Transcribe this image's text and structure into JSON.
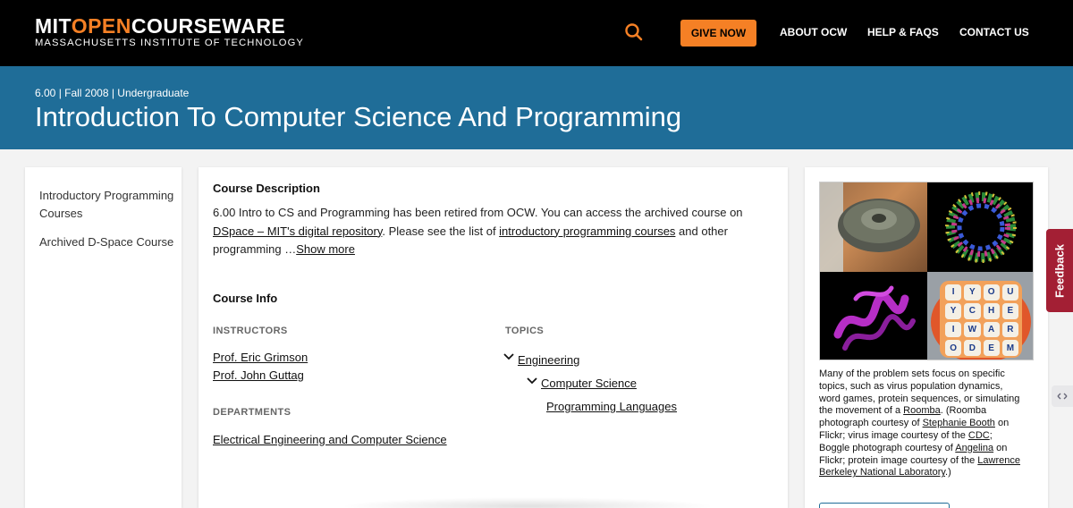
{
  "header": {
    "logo_mit": "MIT",
    "logo_open": "OPEN",
    "logo_courseware": "COURSEWARE",
    "logo_sub": "MASSACHUSETTS INSTITUTE OF TECHNOLOGY",
    "give_now": "GIVE NOW",
    "nav": [
      "ABOUT OCW",
      "HELP & FAQS",
      "CONTACT US"
    ]
  },
  "banner": {
    "meta": "6.00 | Fall 2008 | Undergraduate",
    "title": "Introduction To Computer Science And Programming"
  },
  "sidebar": {
    "items": [
      "Introductory Programming Courses",
      "Archived D-Space Course"
    ]
  },
  "course": {
    "description_heading": "Course Description",
    "desc_1": "6.00 Intro to CS and Programming has been retired from OCW. You can access the archived course on ",
    "desc_link_1": "DSpace – MIT's digital repository",
    "desc_2": ". Please see the list of ",
    "desc_link_2": "introductory programming courses",
    "desc_3": " and other programming …",
    "show_more": "Show more",
    "info_heading": "Course Info",
    "instructors_label": "INSTRUCTORS",
    "instructors": [
      "Prof. Eric Grimson",
      "Prof. John Guttag"
    ],
    "departments_label": "DEPARTMENTS",
    "department": "Electrical Engineering and Computer Science",
    "topics_label": "TOPICS",
    "topics": [
      "Engineering",
      "Computer Science",
      "Programming Languages"
    ]
  },
  "image_caption": {
    "t1": "Many of the problem sets focus on specific topics, such as virus population dynamics, word games, protein sequences, or simulating the movement of a ",
    "l1": "Roomba",
    "t2": ". (Roomba photograph courtesy of ",
    "l2": "Stephanie Booth",
    "t3": " on Flickr; virus image courtesy of the ",
    "l3": "CDC",
    "t4": "; Boggle photograph courtesy of ",
    "l4": "Angelina",
    "t5": " on Flickr; protein image courtesy of the ",
    "l5": "Lawrence Berkeley National Laboratory",
    "t6": ".)"
  },
  "boggle_letters": [
    "I",
    "Y",
    "O",
    "U",
    "Y",
    "C",
    "H",
    "E",
    "I",
    "W",
    "A",
    "R",
    "O",
    "D",
    "E",
    "M"
  ],
  "feedback": "Feedback",
  "colors": {
    "accent": "#f58025",
    "banner": "#1f6d98",
    "feedback": "#a31f34"
  }
}
